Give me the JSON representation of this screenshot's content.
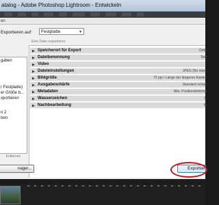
{
  "window": {
    "title": "atalog - Adobe Photoshop Lightroom - Entwickeln"
  },
  "subbar": {
    "label": "en"
  },
  "dialog": {
    "export_to_label": "Exportieren auf:",
    "export_target": "Festplatte",
    "info": "Eine Datei exportieren",
    "left_items": [
      "gaben",
      "",
      "",
      "r Festplatte)",
      "er Größe b...",
      "xportieren",
      "",
      "n 2",
      "ben"
    ],
    "remove_label": "Entfernen",
    "manager_label": "nager...",
    "export_button": "Exportiere",
    "sections": [
      {
        "name": "Speicherort für Export",
        "summary": "Ordn"
      },
      {
        "name": "Dateibenennung",
        "summary": "Test"
      },
      {
        "name": "Video",
        "summary": ""
      },
      {
        "name": "Dateieinstellungen",
        "summary": "JPEG (No more"
      },
      {
        "name": "Bildgröße",
        "summary": "72 ppi / Länge der längeren Kante am"
      },
      {
        "name": "Ausgabeschärfe",
        "summary": "Standard schärf"
      },
      {
        "name": "Metadaten",
        "summary": "Alle, Positionsinforma"
      },
      {
        "name": "Wasserzeichen",
        "summary": "K"
      },
      {
        "name": "Nachbearbeitung",
        "summary": "In"
      }
    ]
  },
  "colors": {
    "highlight_oval": "#c0141a",
    "accent": "#3c7fb1"
  }
}
